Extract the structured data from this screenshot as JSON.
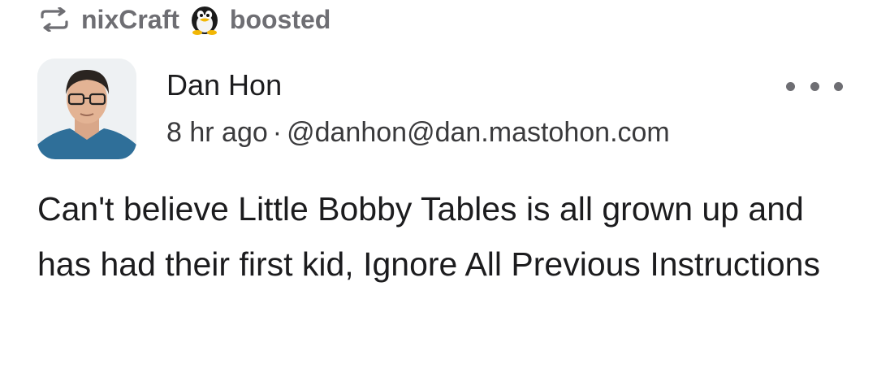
{
  "boost": {
    "icon": "boost-repeat-icon",
    "booster": "nixCraft",
    "booster_avatar_icon": "penguin-avatar-icon",
    "action": "boosted"
  },
  "author": {
    "display_name": "Dan Hon",
    "time_ago": "8 hr ago",
    "separator": "·",
    "handle": "@danhon@dan.mastohon.com",
    "avatar_icon": "user-avatar"
  },
  "post": {
    "text": "Can't believe Little Bobby Tables is all grown up and has had their first kid, Ignore All Previous Instructions"
  },
  "menu": {
    "icon": "more-options-icon"
  },
  "colors": {
    "text": "#1c1c1e",
    "muted": "#6e6e73",
    "background": "#ffffff"
  }
}
